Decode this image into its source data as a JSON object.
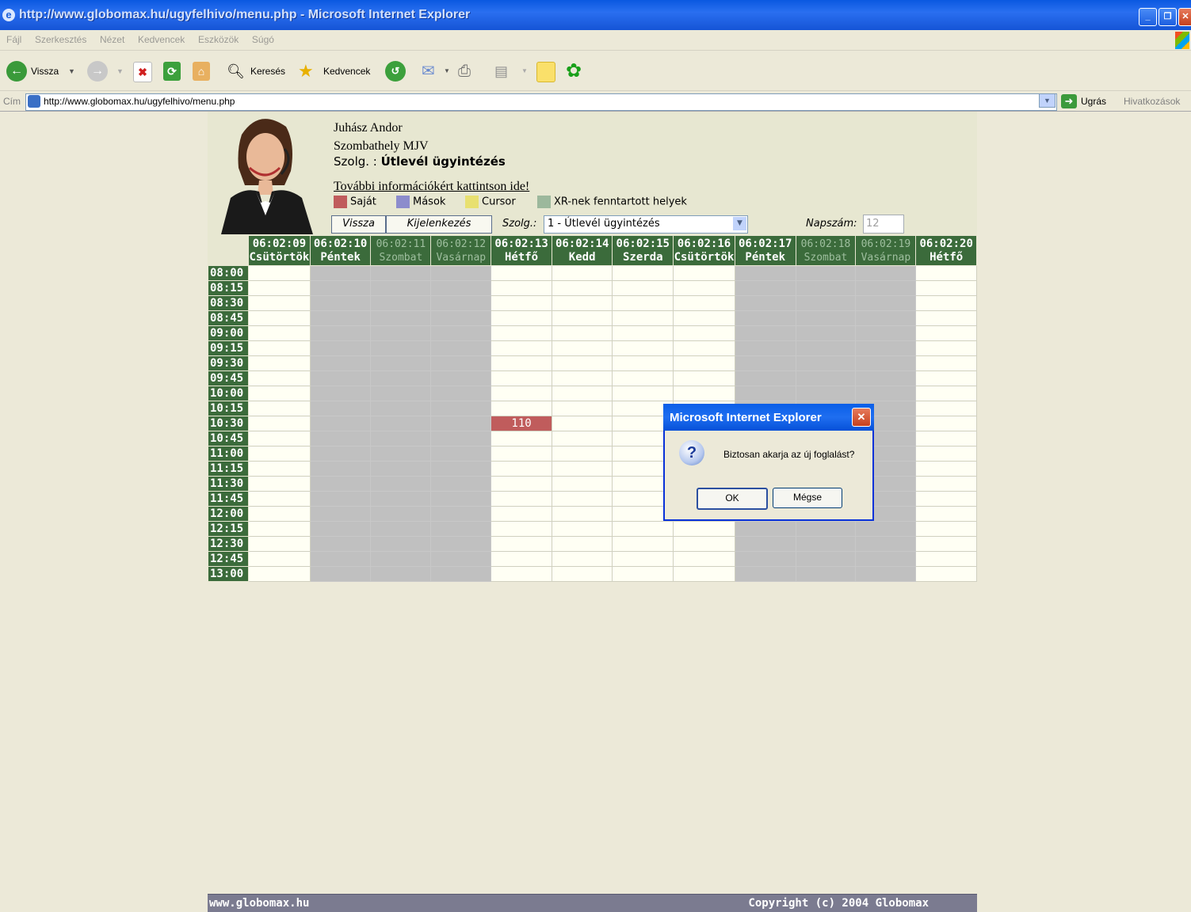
{
  "window": {
    "title": "http://www.globomax.hu/ugyfelhivo/menu.php - Microsoft Internet Explorer",
    "minimize_icon": "minimize-icon",
    "restore_icon": "restore-icon",
    "close_icon": "close-icon"
  },
  "menubar": [
    "Fájl",
    "Szerkesztés",
    "Nézet",
    "Kedvencek",
    "Eszközök",
    "Súgó"
  ],
  "toolbar": {
    "back_label": "Vissza",
    "search_label": "Keresés",
    "favorites_label": "Kedvencek"
  },
  "address": {
    "label": "Cím",
    "url": "http://www.globomax.hu/ugyfelhivo/menu.php",
    "go_label": "Ugrás",
    "links_label": "Hivatkozások"
  },
  "page": {
    "user_name": "Juhász Andor",
    "office": "Szombathely MJV",
    "service_prefix": "Szolg. : ",
    "service_name": "Útlevél ügyintézés",
    "info_link": "További információkért kattintson ide!",
    "legend": [
      {
        "label": "Saját",
        "color": "#c05c5c"
      },
      {
        "label": "Mások",
        "color": "#8c8ccc"
      },
      {
        "label": "Cursor",
        "color": "#e8e070"
      },
      {
        "label": "XR-nek fenntartott helyek",
        "color": "#9cb89c"
      }
    ],
    "back_button": "Vissza",
    "logout_button": "Kijelenkezés",
    "service_select_label": "Szolg.:",
    "service_select_value": "1 - Útlevél ügyintézés",
    "days_label": "Napszám:",
    "days_value": "12"
  },
  "calendar": {
    "days": [
      {
        "date": "06:02:09",
        "name": "Csütörtök",
        "weekend": false
      },
      {
        "date": "06:02:10",
        "name": "Péntek",
        "weekend": false
      },
      {
        "date": "06:02:11",
        "name": "Szombat",
        "weekend": true
      },
      {
        "date": "06:02:12",
        "name": "Vasárnap",
        "weekend": true
      },
      {
        "date": "06:02:13",
        "name": "Hétfő",
        "weekend": false
      },
      {
        "date": "06:02:14",
        "name": "Kedd",
        "weekend": false
      },
      {
        "date": "06:02:15",
        "name": "Szerda",
        "weekend": false
      },
      {
        "date": "06:02:16",
        "name": "Csütörtök",
        "weekend": false
      },
      {
        "date": "06:02:17",
        "name": "Péntek",
        "weekend": false
      },
      {
        "date": "06:02:18",
        "name": "Szombat",
        "weekend": true
      },
      {
        "date": "06:02:19",
        "name": "Vasárnap",
        "weekend": true
      },
      {
        "date": "06:02:20",
        "name": "Hétfő",
        "weekend": false
      }
    ],
    "times": [
      "08:00",
      "08:15",
      "08:30",
      "08:45",
      "09:00",
      "09:15",
      "09:30",
      "09:45",
      "10:00",
      "10:15",
      "10:30",
      "10:45",
      "11:00",
      "11:15",
      "11:30",
      "11:45",
      "12:00",
      "12:15",
      "12:30",
      "12:45",
      "13:00"
    ],
    "grey_days": [
      1,
      2,
      3,
      8,
      9,
      10
    ],
    "booking": {
      "day": 4,
      "time": "10:30",
      "label": "110"
    }
  },
  "footer": {
    "left": "www.globomax.hu",
    "right": "Copyright (c) 2004 Globomax"
  },
  "dialog": {
    "title": "Microsoft Internet Explorer",
    "message": "Biztosan akarja az új foglalást?",
    "ok": "OK",
    "cancel": "Mégse",
    "icon": "question-icon"
  }
}
